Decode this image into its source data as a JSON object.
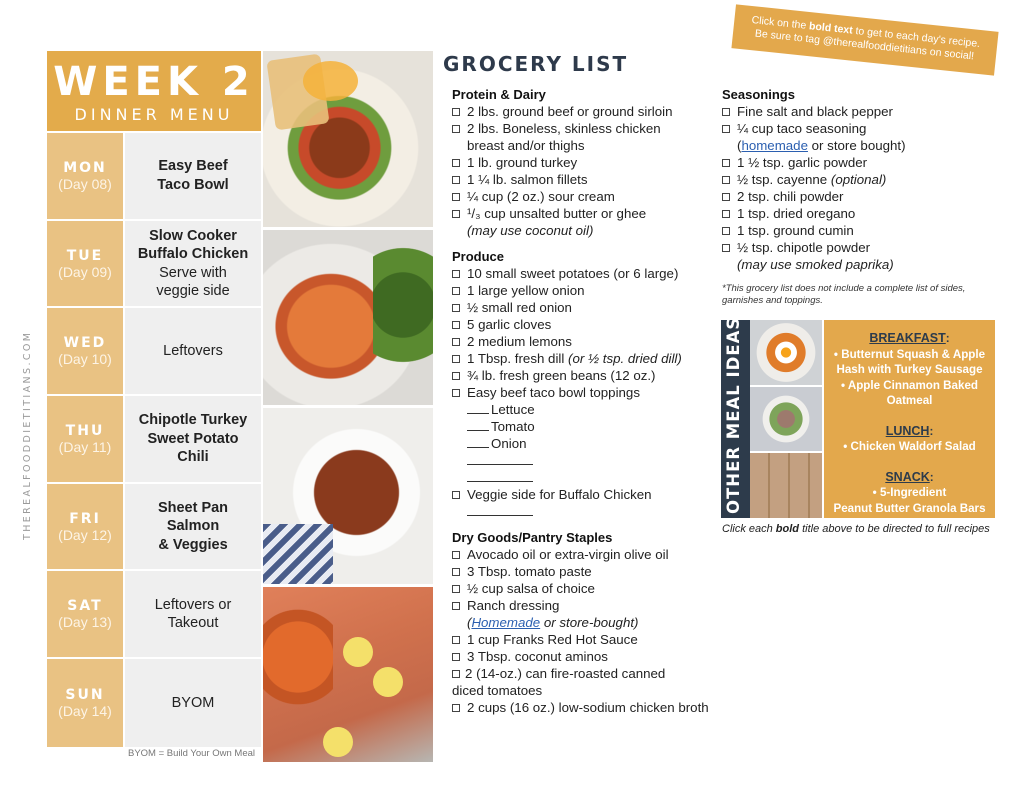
{
  "side_url": "THEREALFOODDIETITIANS.COM",
  "menu": {
    "title": "WEEK 2",
    "subtitle": "DINNER MENU",
    "days": [
      {
        "day": "MON",
        "num": "(Day 08)",
        "meal_bold": [
          "Easy Beef",
          "Taco Bowl"
        ],
        "meal_plain": []
      },
      {
        "day": "TUE",
        "num": "(Day 09)",
        "meal_bold": [
          "Slow Cooker",
          "Buffalo Chicken"
        ],
        "meal_plain": [
          "Serve with",
          "veggie side"
        ]
      },
      {
        "day": "WED",
        "num": "(Day 10)",
        "meal_bold": [],
        "meal_plain": [
          "Leftovers"
        ]
      },
      {
        "day": "THU",
        "num": "(Day 11)",
        "meal_bold": [
          "Chipotle Turkey",
          "Sweet Potato",
          "Chili"
        ],
        "meal_plain": []
      },
      {
        "day": "FRI",
        "num": "(Day 12)",
        "meal_bold": [
          "Sheet Pan",
          "Salmon",
          "& Veggies"
        ],
        "meal_plain": []
      },
      {
        "day": "SAT",
        "num": "(Day 13)",
        "meal_bold": [],
        "meal_plain": [
          "Leftovers or",
          "Takeout"
        ]
      },
      {
        "day": "SUN",
        "num": "(Day 14)",
        "meal_bold": [],
        "meal_plain": [
          "BYOM"
        ]
      }
    ],
    "note": "BYOM = Build Your Own Meal"
  },
  "photos": [
    "Easy beef taco bowl",
    "Buffalo chicken stuffed sweet potato",
    "Chipotle turkey sweet potato chili",
    "Sheet pan salmon & veggies"
  ],
  "grocery": {
    "title": "GROCERY LIST",
    "protein": {
      "heading": "Protein & Dairy",
      "items": [
        {
          "text": "2 lbs. ground beef or ground sirloin"
        },
        {
          "text": "2 lbs. Boneless, skinless chicken",
          "cont": "breast and/or thighs"
        },
        {
          "text": "1 lb. ground turkey"
        },
        {
          "text": "1 ¼ lb. salmon fillets"
        },
        {
          "text": "¼ cup (2 oz.) sour cream"
        },
        {
          "text": " ¹/₃ cup unsalted butter or ghee",
          "note": "(may use coconut oil)"
        }
      ]
    },
    "produce": {
      "heading": "Produce",
      "items": [
        {
          "text": "10 small sweet potatoes (or 6 large)"
        },
        {
          "text": "1 large yellow onion"
        },
        {
          "text": "½ small red onion"
        },
        {
          "text": "5 garlic cloves"
        },
        {
          "text": "2 medium lemons"
        },
        {
          "text": "1 Tbsp. fresh dill ",
          "italic": "(or ½ tsp. dried dill)"
        },
        {
          "text": "¾ lb. fresh green beans (12 oz.)"
        },
        {
          "text": "Easy beef taco bowl toppings"
        }
      ],
      "toppings": [
        "Lettuce",
        "Tomato",
        "Onion"
      ],
      "veggie_side": "Veggie side for Buffalo Chicken"
    },
    "dry": {
      "heading": "Dry Goods/Pantry Staples",
      "items": [
        {
          "text": "Avocado oil or extra-virgin olive oil"
        },
        {
          "text": "3 Tbsp. tomato paste"
        },
        {
          "text": "½ cup salsa of choice"
        },
        {
          "text": "Ranch dressing"
        }
      ],
      "ranch_link": "Homemade",
      "ranch_rest": " or store-bought)",
      "items2": [
        {
          "text": "1 cup Franks Red Hot Sauce"
        },
        {
          "text": "3 Tbsp. coconut aminos"
        }
      ],
      "tomatoes_a": "2 (14-oz.) can fire-roasted canned",
      "tomatoes_b": "diced tomatoes",
      "broth": "2 cups (16 oz.) low-sodium chicken broth"
    }
  },
  "banner": {
    "pre": "Click on the ",
    "bold": "bold text",
    "post": " to get to each day's recipe.",
    "line2": "Be sure to tag @therealfooddietitians on social!"
  },
  "seasonings": {
    "heading": "Seasonings",
    "item1": "Fine salt and black pepper",
    "item2": "¼ cup taco seasoning",
    "item2_link": "homemade",
    "item2_rest": " or store bought)",
    "items": [
      {
        "text": "1 ½ tsp. garlic powder"
      },
      {
        "text": "½  tsp. cayenne ",
        "italic": "(optional)"
      },
      {
        "text": "2 tsp. chili powder"
      },
      {
        "text": "1 tsp. dried oregano"
      },
      {
        "text": "1 tsp. ground cumin"
      },
      {
        "text": "½ tsp. chipotle powder",
        "note": "(may use smoked paprika)"
      }
    ],
    "disclaimer": "*This grocery list does not include a complete list of sides, garnishes and toppings."
  },
  "meal_ideas": {
    "tab": "OTHER MEAL IDEAS",
    "breakfast_head": "BREAKFAST",
    "breakfast_items": [
      "• Butternut Squash & Apple Hash with Turkey Sausage",
      "• Apple Cinnamon Baked Oatmeal"
    ],
    "lunch_head": "LUNCH",
    "lunch_items": [
      "• Chicken Waldorf Salad"
    ],
    "snack_head": "SNACK",
    "snack_items": [
      "• 5-Ingredient",
      "Peanut Butter Granola Bars"
    ],
    "caption_pre": "Click each ",
    "caption_bold": "bold",
    "caption_post": " title above to be directed to full recipes"
  },
  "colors": {
    "gold": "#e3ab4b",
    "light_gold": "#e9c283",
    "navy": "#2d3b4b",
    "link": "#2b5fb0"
  }
}
